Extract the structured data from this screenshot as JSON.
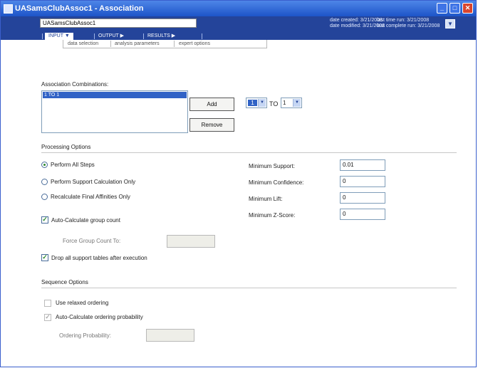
{
  "window": {
    "title": "UASamsClubAssoc1 - Association"
  },
  "header": {
    "name_value": "UASamsClubAssoc1",
    "date_created": "date created: 3/21/2008",
    "date_modified": "date modified: 3/21/2008",
    "last_time_run": "last time run: 3/21/2008",
    "last_complete_run": "last complete run: 3/21/2008"
  },
  "nav": {
    "input": "INPUT ▼",
    "output": "OUTPUT ▶",
    "results": "RESULTS ▶"
  },
  "subtabs": {
    "data_selection": "data selection",
    "analysis_parameters": "analysis parameters",
    "expert_options": "expert options"
  },
  "association": {
    "title": "Association Combinations:",
    "list_items": [
      "1 TO 1"
    ],
    "add_label": "Add",
    "remove_label": "Remove",
    "from_value": "1",
    "to_label": "TO",
    "to_value": "1"
  },
  "processing": {
    "title": "Processing Options",
    "radio_options": [
      "Perform All Steps",
      "Perform Support Calculation Only",
      "Recalculate Final Affinities Only"
    ],
    "selected_radio": 0,
    "auto_calc_label": "Auto-Calculate group count",
    "auto_calc_checked": true,
    "force_group_label": "Force Group Count To:",
    "force_group_value": "",
    "drop_tables_label": "Drop all support tables after execution",
    "drop_tables_checked": true,
    "min_support_label": "Minimum Support:",
    "min_support_value": "0.01",
    "min_confidence_label": "Minimum Confidence:",
    "min_confidence_value": "0",
    "min_lift_label": "Minimum Lift:",
    "min_lift_value": "0",
    "min_zscore_label": "Minimum Z-Score:",
    "min_zscore_value": "0"
  },
  "sequence": {
    "title": "Sequence Options",
    "relaxed_label": "Use relaxed ordering",
    "relaxed_checked": false,
    "auto_prob_label": "Auto-Calculate ordering probability",
    "auto_prob_checked": true,
    "prob_label": "Ordering Probability:",
    "prob_value": ""
  },
  "colors": {
    "title_bar": "#1d54c8",
    "header_band": "#24449a",
    "selection": "#3163c6",
    "check_mark": "#2c8a2c"
  }
}
